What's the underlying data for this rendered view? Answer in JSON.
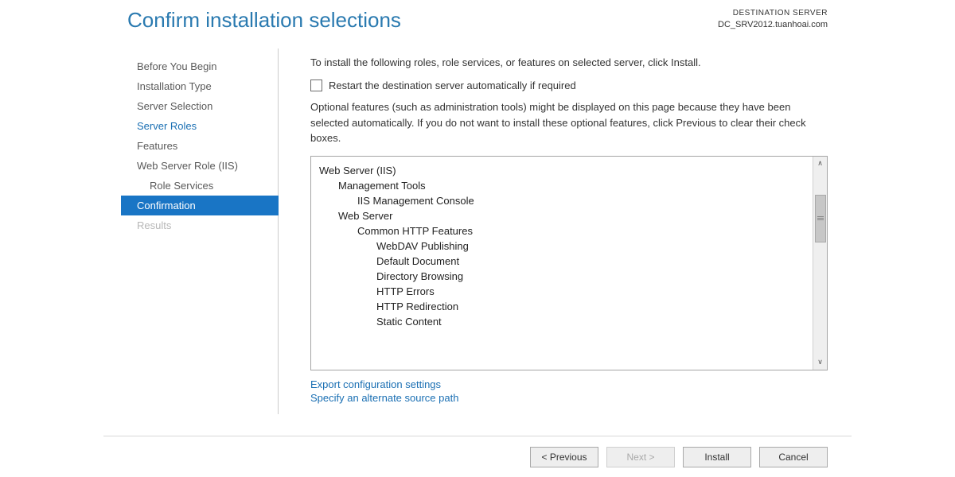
{
  "header": {
    "title": "Confirm installation selections",
    "dest_label": "DESTINATION SERVER",
    "dest_value": "DC_SRV2012.tuanhoai.com"
  },
  "sidebar": {
    "items": [
      {
        "label": "Before You Begin",
        "indent": false,
        "state": "normal"
      },
      {
        "label": "Installation Type",
        "indent": false,
        "state": "normal"
      },
      {
        "label": "Server Selection",
        "indent": false,
        "state": "normal"
      },
      {
        "label": "Server Roles",
        "indent": false,
        "state": "link"
      },
      {
        "label": "Features",
        "indent": false,
        "state": "normal"
      },
      {
        "label": "Web Server Role (IIS)",
        "indent": false,
        "state": "normal"
      },
      {
        "label": "Role Services",
        "indent": true,
        "state": "normal"
      },
      {
        "label": "Confirmation",
        "indent": false,
        "state": "active"
      },
      {
        "label": "Results",
        "indent": false,
        "state": "disabled"
      }
    ]
  },
  "content": {
    "intro": "To install the following roles, role services, or features on selected server, click Install.",
    "restart_label": "Restart the destination server automatically if required",
    "optional_text": "Optional features (such as administration tools) might be displayed on this page because they have been selected automatically. If you do not want to install these optional features, click Previous to clear their check boxes.",
    "tree": [
      {
        "label": "Web Server (IIS)",
        "level": 0
      },
      {
        "label": "Management Tools",
        "level": 1
      },
      {
        "label": "IIS Management Console",
        "level": 2
      },
      {
        "label": "Web Server",
        "level": 1
      },
      {
        "label": "Common HTTP Features",
        "level": 2
      },
      {
        "label": "WebDAV Publishing",
        "level": 3
      },
      {
        "label": "Default Document",
        "level": 3
      },
      {
        "label": "Directory Browsing",
        "level": 3
      },
      {
        "label": "HTTP Errors",
        "level": 3
      },
      {
        "label": "HTTP Redirection",
        "level": 3
      },
      {
        "label": "Static Content",
        "level": 3
      }
    ],
    "link_export": "Export configuration settings",
    "link_source": "Specify an alternate source path"
  },
  "footer": {
    "previous": "< Previous",
    "next": "Next >",
    "install": "Install",
    "cancel": "Cancel"
  }
}
